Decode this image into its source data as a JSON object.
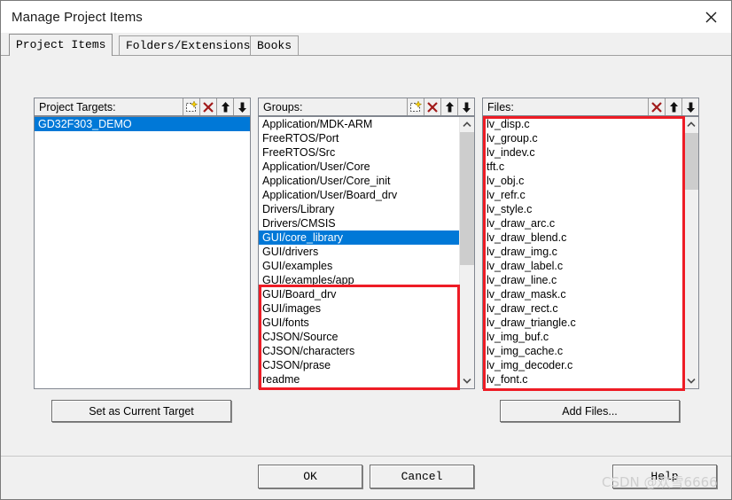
{
  "window": {
    "title": "Manage Project Items",
    "close_icon": "close-icon"
  },
  "tabs": [
    {
      "label": "Project Items",
      "selected": true
    },
    {
      "label": "Folders/Extensions",
      "selected": false
    },
    {
      "label": "Books",
      "selected": false
    }
  ],
  "panels": {
    "targets": {
      "header_label": "Project Targets:",
      "tools": [
        "new-item-icon",
        "delete-icon",
        "move-up-icon",
        "move-down-icon"
      ],
      "items": [
        "GD32F303_DEMO"
      ],
      "selected_index": 0
    },
    "groups": {
      "header_label": "Groups:",
      "tools": [
        "new-item-icon",
        "delete-icon",
        "move-up-icon",
        "move-down-icon"
      ],
      "items": [
        "Application/MDK-ARM",
        "FreeRTOS/Port",
        "FreeRTOS/Src",
        "Application/User/Core",
        "Application/User/Core_init",
        "Application/User/Board_drv",
        "Drivers/Library",
        "Drivers/CMSIS",
        "GUI/core_library",
        "GUI/drivers",
        "GUI/examples",
        "GUI/examples/app",
        "GUI/Board_drv",
        "GUI/images",
        "GUI/fonts",
        "CJSON/Source",
        "CJSON/characters",
        "CJSON/prase",
        "readme"
      ],
      "selected_index": 8,
      "scrollbar": {
        "up_icon": "chevron-up-icon",
        "down_icon": "chevron-down-icon"
      }
    },
    "files": {
      "header_label": "Files:",
      "tools": [
        "delete-icon",
        "move-up-icon",
        "move-down-icon"
      ],
      "items": [
        "lv_disp.c",
        "lv_group.c",
        "lv_indev.c",
        "tft.c",
        "lv_obj.c",
        "lv_refr.c",
        "lv_style.c",
        "lv_draw_arc.c",
        "lv_draw_blend.c",
        "lv_draw_img.c",
        "lv_draw_label.c",
        "lv_draw_line.c",
        "lv_draw_mask.c",
        "lv_draw_rect.c",
        "lv_draw_triangle.c",
        "lv_img_buf.c",
        "lv_img_cache.c",
        "lv_img_decoder.c",
        "lv_font.c"
      ],
      "selected_index": -1,
      "scrollbar": {
        "up_icon": "chevron-up-icon",
        "down_icon": "chevron-down-icon"
      }
    }
  },
  "buttons": {
    "set_current_target": "Set as Current Target",
    "add_files": "Add Files...",
    "ok": "OK",
    "cancel": "Cancel",
    "help": "Help"
  },
  "annotations": {
    "highlight_color": "#ee1c25",
    "groups_highlight_label": "GUI groups highlight",
    "files_highlight_label": "Files list highlight"
  },
  "watermark": {
    "text": "CSDN @欢雪6666"
  },
  "colors": {
    "selection": "#0078d7",
    "dialog_bg": "#f0f0f0",
    "list_bg": "#ffffff",
    "accent_red": "#ee1c25"
  }
}
